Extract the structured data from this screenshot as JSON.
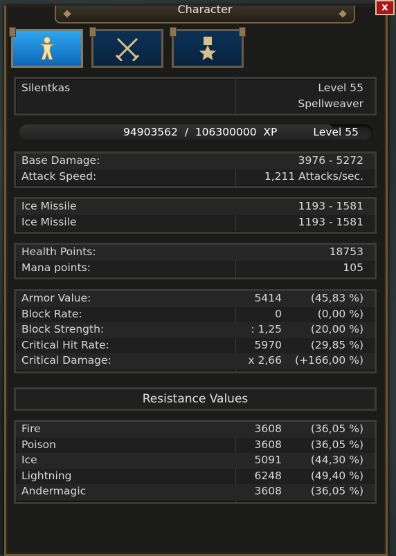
{
  "window": {
    "title": "Character",
    "close_label": "x"
  },
  "tabs": [
    {
      "icon": "person-icon",
      "active": true
    },
    {
      "icon": "crossed-swords-icon",
      "active": false
    },
    {
      "icon": "star-medal-icon",
      "active": false
    }
  ],
  "character": {
    "name": "Silentkas",
    "level": "Level 55",
    "class": "Spellweaver"
  },
  "xp": {
    "text": "94903562  /  106300000  XP",
    "level": "Level  55",
    "progress": 0.893
  },
  "damage": [
    {
      "label": "Base Damage:",
      "value": "3976  -  5272"
    },
    {
      "label": "Attack Speed:",
      "value": "1,211  Attacks/sec."
    }
  ],
  "skills": [
    {
      "label": "Ice  Missile",
      "value": "1193  -  1581"
    },
    {
      "label": "Ice  Missile",
      "value": "1193  -  1581"
    }
  ],
  "vitals": [
    {
      "label": "Health Points:",
      "value": "18753"
    },
    {
      "label": "Mana points:",
      "value": "105"
    }
  ],
  "defense": [
    {
      "label": "Armor Value:",
      "value": "5414",
      "percent": "(45,83  %)"
    },
    {
      "label": "Block Rate:",
      "value": "0",
      "percent": "(0,00  %)"
    },
    {
      "label": "Block Strength:",
      "value": ":  1,25",
      "percent": "(20,00  %)"
    },
    {
      "label": "Critical Hit Rate:",
      "value": "5970",
      "percent": "(29,85  %)"
    },
    {
      "label": "Critical Damage:",
      "value": "x  2,66",
      "percent": "(+166,00  %)"
    }
  ],
  "resistance_title": "Resistance Values",
  "resistances": [
    {
      "label": "Fire",
      "value": "3608",
      "percent": "(36,05  %)"
    },
    {
      "label": "Poison",
      "value": "3608",
      "percent": "(36,05  %)"
    },
    {
      "label": "Ice",
      "value": "5091",
      "percent": "(44,30  %)"
    },
    {
      "label": "Lightning",
      "value": "6248",
      "percent": "(49,40  %)"
    },
    {
      "label": "Andermagic",
      "value": "3608",
      "percent": "(36,05  %)"
    }
  ]
}
